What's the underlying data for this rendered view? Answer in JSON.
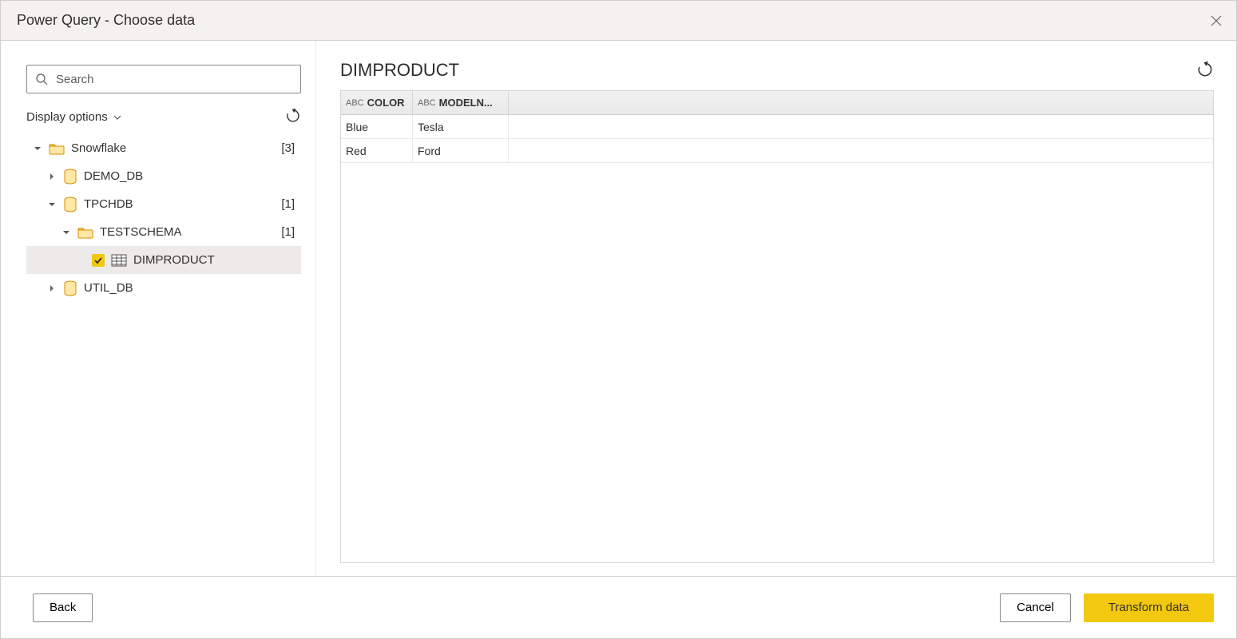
{
  "window": {
    "title": "Power Query - Choose data"
  },
  "search": {
    "placeholder": "Search"
  },
  "sidebar": {
    "display_options_label": "Display options",
    "tree": {
      "root": {
        "label": "Snowflake",
        "count": "[3]"
      },
      "demo_db": {
        "label": "DEMO_DB"
      },
      "tpchdb": {
        "label": "TPCHDB",
        "count": "[1]"
      },
      "testschema": {
        "label": "TESTSCHEMA",
        "count": "[1]"
      },
      "dimproduct": {
        "label": "DIMPRODUCT"
      },
      "util_db": {
        "label": "UTIL_DB"
      }
    }
  },
  "preview": {
    "title": "DIMPRODUCT",
    "columns": [
      {
        "type": "ABC",
        "name": "COLOR"
      },
      {
        "type": "ABC",
        "name": "MODELN..."
      }
    ],
    "rows": [
      {
        "c0": "Blue",
        "c1": "Tesla"
      },
      {
        "c0": "Red",
        "c1": "Ford"
      }
    ]
  },
  "footer": {
    "back": "Back",
    "cancel": "Cancel",
    "transform": "Transform data"
  },
  "colors": {
    "accent": "#f2c811"
  }
}
